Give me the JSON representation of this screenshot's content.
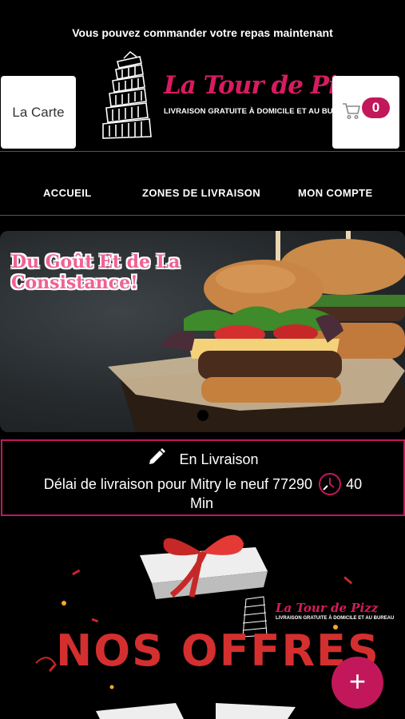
{
  "header": {
    "banner": "Vous pouvez commander votre repas maintenant",
    "carte_label": "La Carte",
    "logo_title": "La Tour de Pizz",
    "logo_subtitle": "LIVRAISON GRATUITE À DOMICILE ET AU BUREAU",
    "cart_count": "0"
  },
  "nav": {
    "items": [
      "ACCUEIL",
      "ZONES DE LIVRAISON",
      "MON COMPTE"
    ]
  },
  "hero": {
    "slogan_line1": "Du Goût Et de La",
    "slogan_line2": "Consistance!"
  },
  "delivery": {
    "mode": "En Livraison",
    "delay_text": "Délai de livraison pour Mitry le neuf 77290",
    "delay_value": "40",
    "delay_unit": "Min"
  },
  "offers": {
    "title": "NOS OFFRES",
    "logo_title": "La Tour de Pizz",
    "logo_subtitle": "LIVRAISON GRATUITE À DOMICILE ET AU BUREAU"
  },
  "fab": {
    "label": "+"
  },
  "colors": {
    "accent": "#c2185b",
    "background": "#000000"
  },
  "icons": [
    "cart-icon",
    "pencil-icon",
    "clock-icon",
    "plus-icon",
    "tower-logo-icon"
  ]
}
